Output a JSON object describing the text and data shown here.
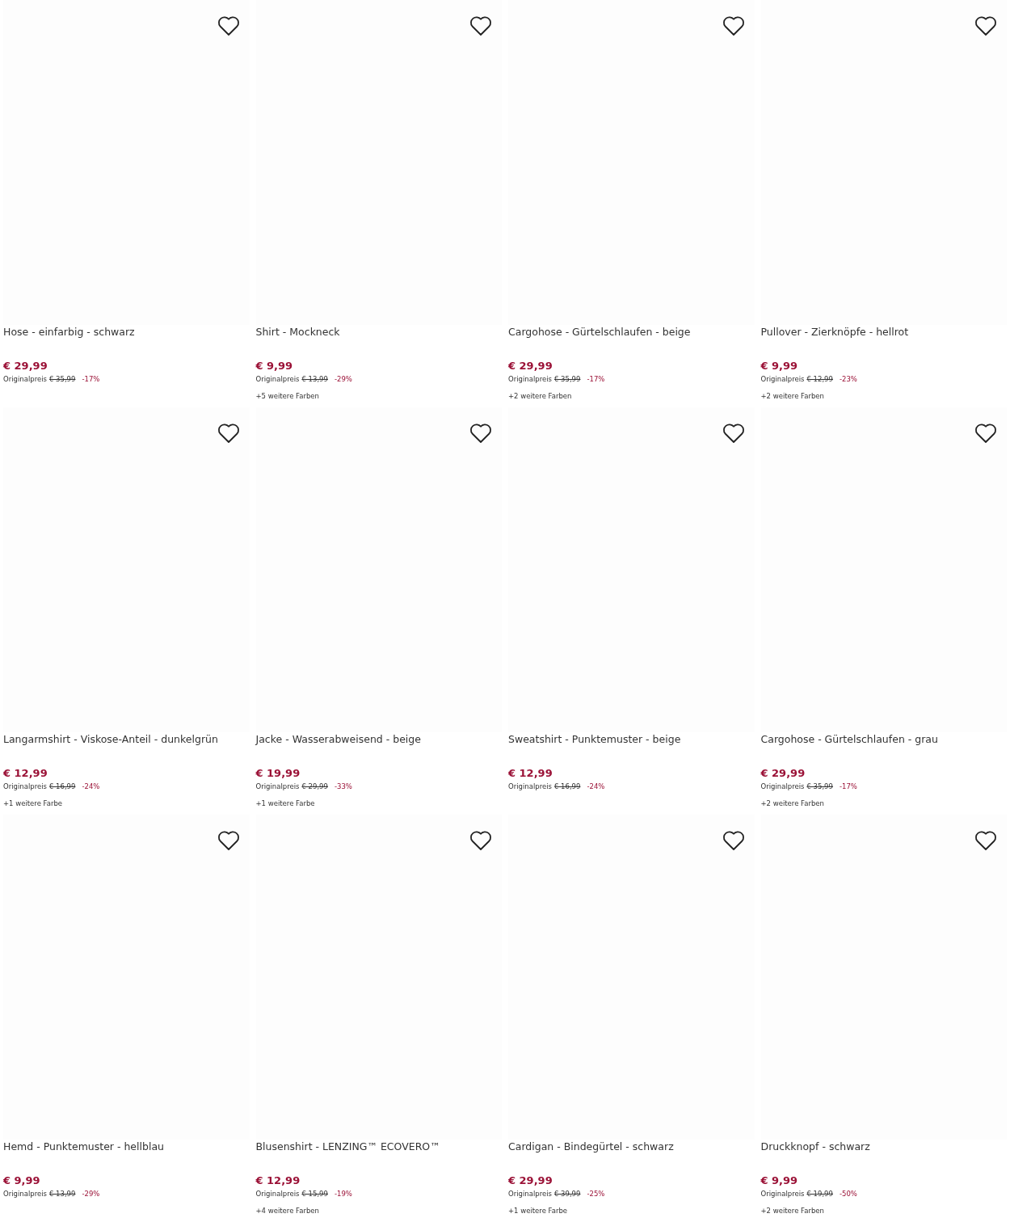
{
  "products": [
    {
      "title": "Hose - einfarbig - schwarz",
      "price": "€ 29,99",
      "original_label": "Originalpreis",
      "original_price": "€ 35,99",
      "discount": "-17%"
    },
    {
      "title": "Shirt - Mockneck",
      "price": "€ 9,99",
      "original_label": "Originalpreis",
      "original_price": "€ 13,99",
      "discount": "-29%",
      "colors": "+5 weitere Farben"
    },
    {
      "title": "Cargohose - Gürtelschlaufen - beige",
      "price": "€ 29,99",
      "original_label": "Originalpreis",
      "original_price": "€ 35,99",
      "discount": "-17%",
      "colors": "+2 weitere Farben"
    },
    {
      "title": "Pullover - Zierknöpfe - hellrot",
      "price": "€ 9,99",
      "original_label": "Originalpreis",
      "original_price": "€ 12,99",
      "discount": "-23%",
      "colors": "+2 weitere Farben"
    },
    {
      "title": "Langarmshirt - Viskose-Anteil - dunkelgrün",
      "price": "€ 12,99",
      "original_label": "Originalpreis",
      "original_price": "€ 16,99",
      "discount": "-24%",
      "colors": "+1 weitere Farbe"
    },
    {
      "title": "Jacke - Wasserabweisend - beige",
      "price": "€ 19,99",
      "original_label": "Originalpreis",
      "original_price": "€ 29,99",
      "discount": "-33%",
      "colors": "+1 weitere Farbe"
    },
    {
      "title": "Sweatshirt - Punktemuster - beige",
      "price": "€ 12,99",
      "original_label": "Originalpreis",
      "original_price": "€ 16,99",
      "discount": "-24%"
    },
    {
      "title": "Cargohose - Gürtelschlaufen - grau",
      "price": "€ 29,99",
      "original_label": "Originalpreis",
      "original_price": "€ 35,99",
      "discount": "-17%",
      "colors": "+2 weitere Farben"
    },
    {
      "title": "Hemd - Punktemuster - hellblau",
      "price": "€ 9,99",
      "original_label": "Originalpreis",
      "original_price": "€ 13,99",
      "discount": "-29%"
    },
    {
      "title": "Blusenshirt - LENZING™ ECOVERO™",
      "price": "€ 12,99",
      "original_label": "Originalpreis",
      "original_price": "€ 15,99",
      "discount": "-19%",
      "colors": "+4 weitere Farben"
    },
    {
      "title": "Cardigan - Bindegürtel - schwarz",
      "price": "€ 29,99",
      "original_label": "Originalpreis",
      "original_price": "€ 39,99",
      "discount": "-25%",
      "colors": "+1 weitere Farbe"
    },
    {
      "title": "Druckknopf - schwarz",
      "price": "€ 9,99",
      "original_label": "Originalpreis",
      "original_price": "€ 19,99",
      "discount": "-50%",
      "colors": "+2 weitere Farben"
    }
  ]
}
